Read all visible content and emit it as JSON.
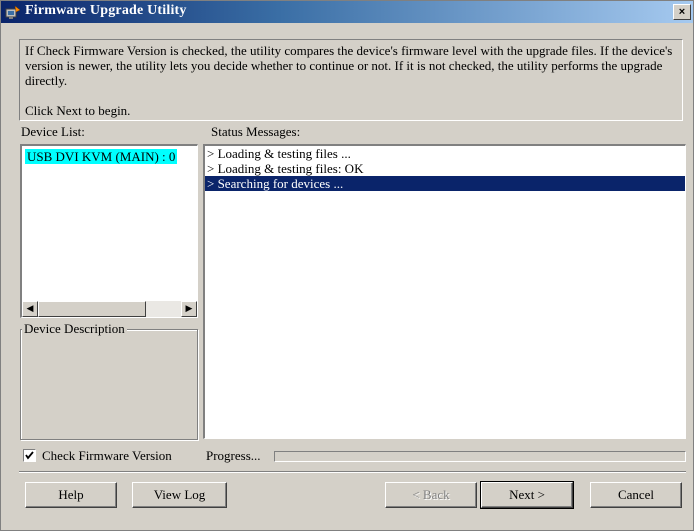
{
  "window": {
    "title": "Firmware Upgrade Utility",
    "close_label": "×"
  },
  "info": {
    "text": "If Check Firmware Version is checked, the utility compares the device's firmware level with the upgrade files. If the device's version is newer, the utility lets you decide whether to continue or not. If it is not checked, the utility performs the upgrade directly.",
    "next_hint": "Click Next to begin."
  },
  "device_list": {
    "label": "Device List:",
    "items": [
      "USB DVI KVM (MAIN) : 0"
    ],
    "selected_index": 0
  },
  "device_description": {
    "label": "Device Description"
  },
  "status_messages": {
    "label": "Status Messages:",
    "lines": [
      "> Loading & testing files ...",
      "> Loading & testing files: OK",
      "> Searching for devices ..."
    ],
    "selected_index": 2
  },
  "check_firmware": {
    "label": "Check Firmware Version",
    "checked": true
  },
  "progress": {
    "label": "Progress...",
    "value": 0
  },
  "buttons": {
    "help": "Help",
    "view_log": "View Log",
    "back": "< Back",
    "next": "Next >",
    "cancel": "Cancel"
  },
  "colors": {
    "title_bar": "#0a246a",
    "selection_cyan": "#00ffff",
    "selection_blue": "#0a246a",
    "window_bg": "#d4d0c8"
  }
}
